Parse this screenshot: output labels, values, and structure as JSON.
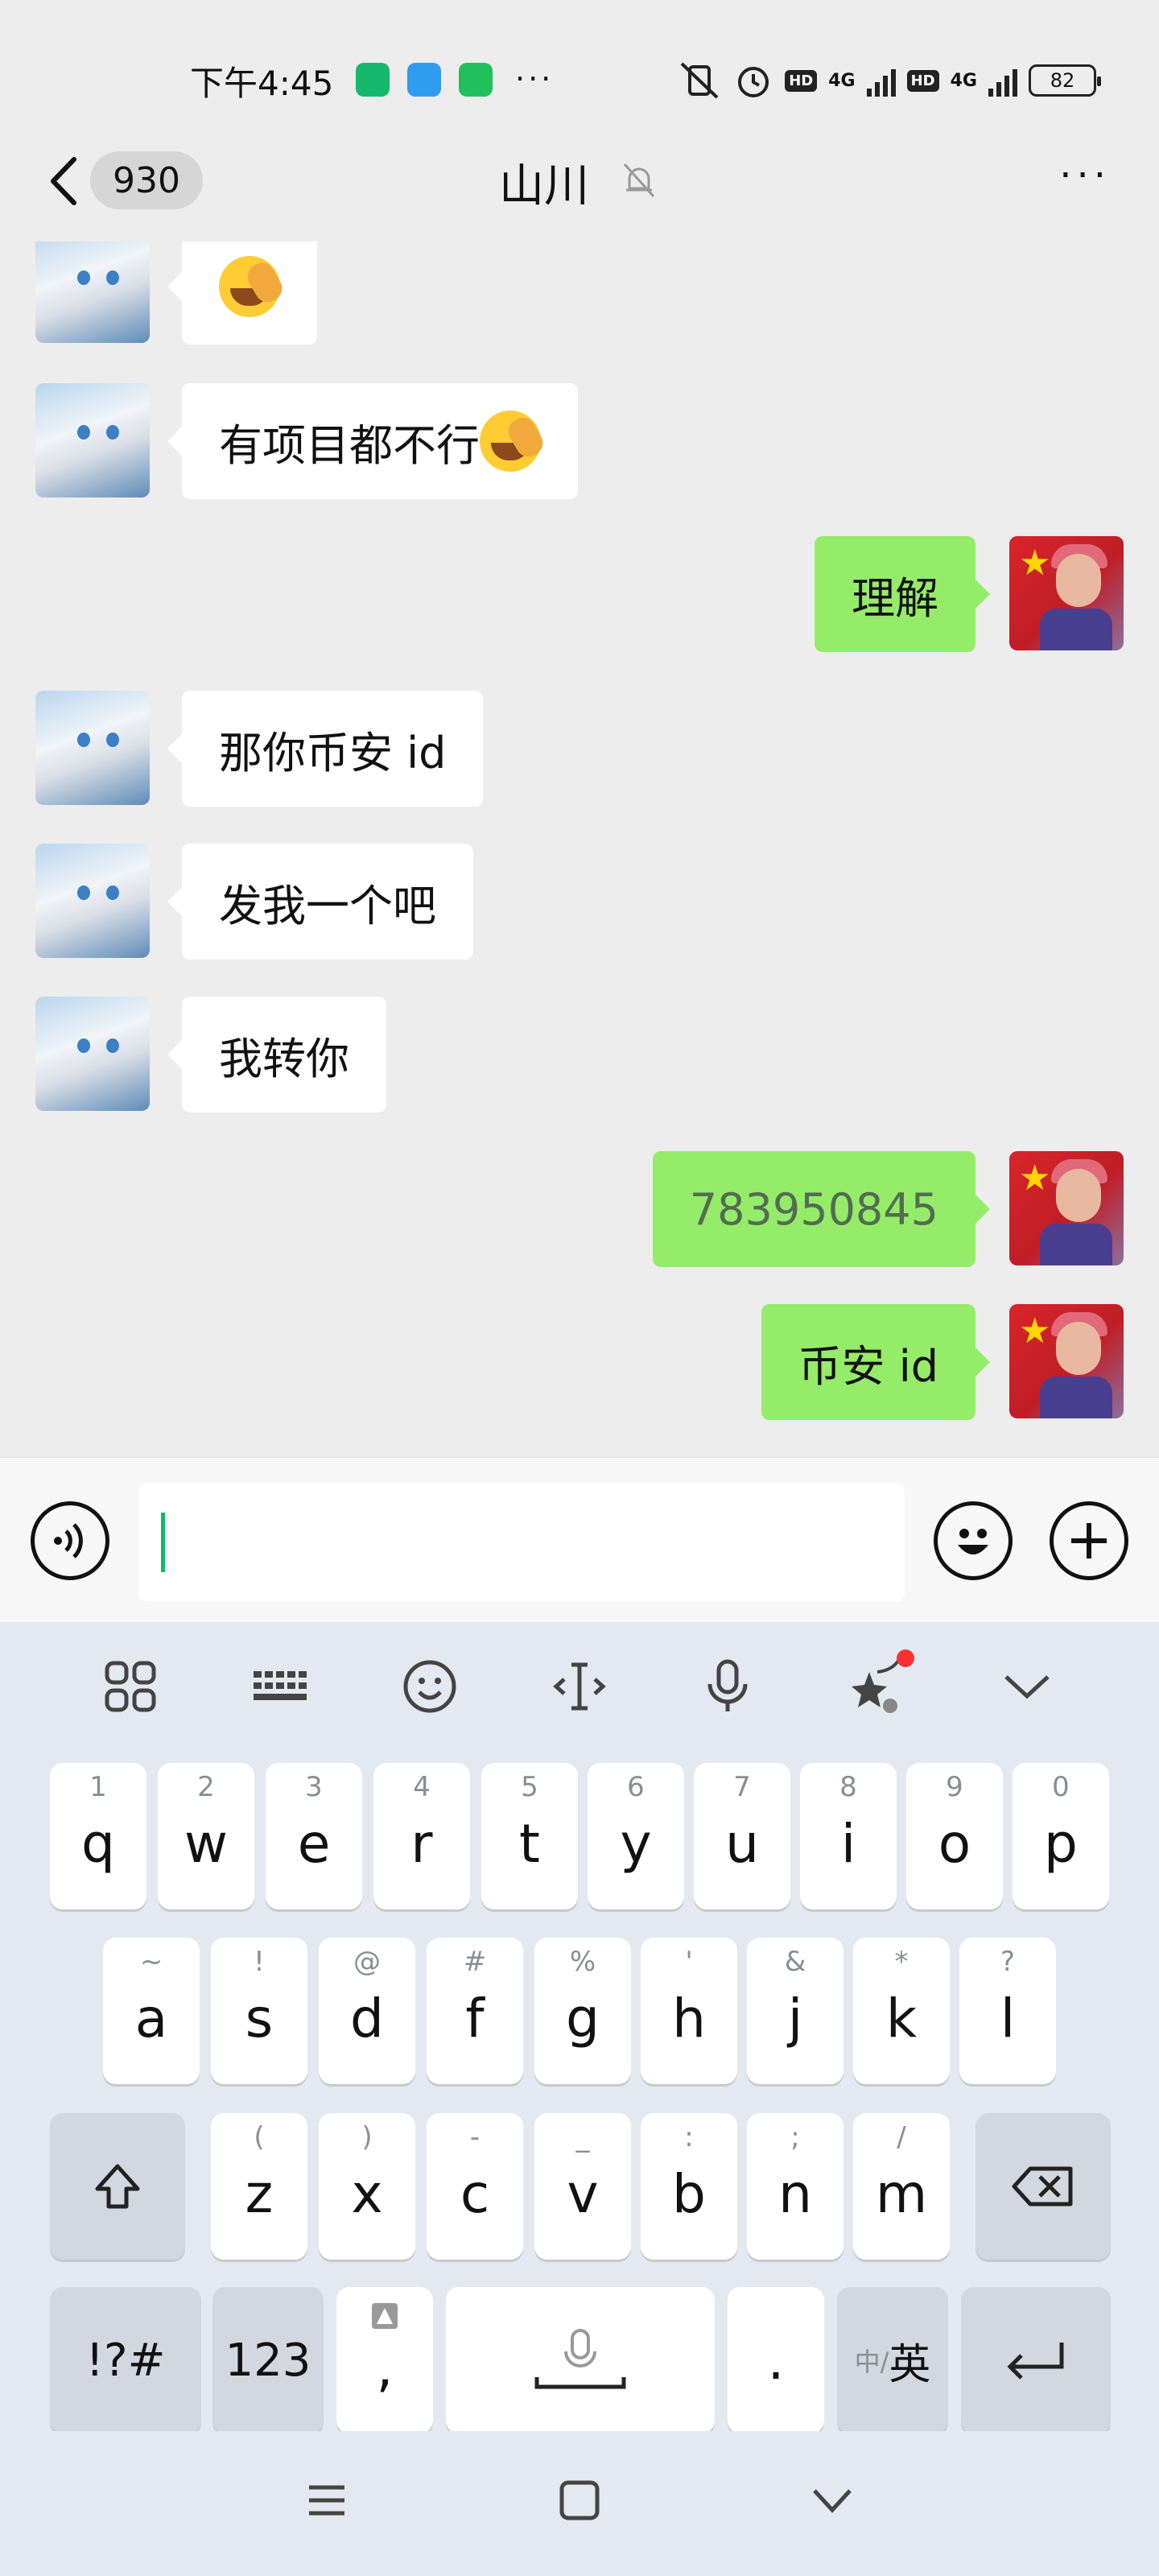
{
  "status_bar": {
    "time": "下午4:45",
    "dots": "···",
    "hd1": "HD",
    "net1": "4G",
    "hd2": "HD",
    "net2": "4G",
    "battery": "82"
  },
  "header": {
    "back_label": "<",
    "unread_count": "930",
    "title": "山川",
    "more_label": "···"
  },
  "messages": [
    {
      "side": "left",
      "text": "",
      "emoji": "face-with-tears-of-joy-icon"
    },
    {
      "side": "left",
      "text": "有项目都不行",
      "emoji": "face-with-tears-of-joy-icon"
    },
    {
      "side": "right",
      "text": "理解"
    },
    {
      "side": "left",
      "text": "那你币安 id"
    },
    {
      "side": "left",
      "text": "发我一个吧"
    },
    {
      "side": "left",
      "text": "我转你"
    },
    {
      "side": "right",
      "text": "783950845"
    },
    {
      "side": "right",
      "text": "币安 id"
    }
  ],
  "input": {
    "value": ""
  },
  "keyboard": {
    "toolbar": [
      "apps-grid-icon",
      "keyboard-icon",
      "emoji-icon",
      "cursor-icon",
      "microphone-icon",
      "ai-star-icon",
      "collapse-chevron-icon"
    ],
    "row1": [
      {
        "key": "q",
        "hint": "1"
      },
      {
        "key": "w",
        "hint": "2"
      },
      {
        "key": "e",
        "hint": "3"
      },
      {
        "key": "r",
        "hint": "4"
      },
      {
        "key": "t",
        "hint": "5"
      },
      {
        "key": "y",
        "hint": "6"
      },
      {
        "key": "u",
        "hint": "7"
      },
      {
        "key": "i",
        "hint": "8"
      },
      {
        "key": "o",
        "hint": "9"
      },
      {
        "key": "p",
        "hint": "0"
      }
    ],
    "row2": [
      {
        "key": "a",
        "hint": "~"
      },
      {
        "key": "s",
        "hint": "!"
      },
      {
        "key": "d",
        "hint": "@"
      },
      {
        "key": "f",
        "hint": "#"
      },
      {
        "key": "g",
        "hint": "%"
      },
      {
        "key": "h",
        "hint": "'"
      },
      {
        "key": "j",
        "hint": "&"
      },
      {
        "key": "k",
        "hint": "*"
      },
      {
        "key": "l",
        "hint": "?"
      }
    ],
    "row3": [
      {
        "key": "z",
        "hint": "("
      },
      {
        "key": "x",
        "hint": ")"
      },
      {
        "key": "c",
        "hint": "-"
      },
      {
        "key": "v",
        "hint": "_"
      },
      {
        "key": "b",
        "hint": ":"
      },
      {
        "key": "n",
        "hint": ";"
      },
      {
        "key": "m",
        "hint": "/"
      }
    ],
    "symbols_label": "!?#",
    "numbers_label": "123",
    "comma_label": ",",
    "period_label": ".",
    "lang_label_small": "中/",
    "lang_label": "英"
  },
  "colors": {
    "sent_bubble": "#95ec69",
    "received_bubble": "#ffffff",
    "caret": "#07c160",
    "notification_dot": "#ff3030"
  }
}
